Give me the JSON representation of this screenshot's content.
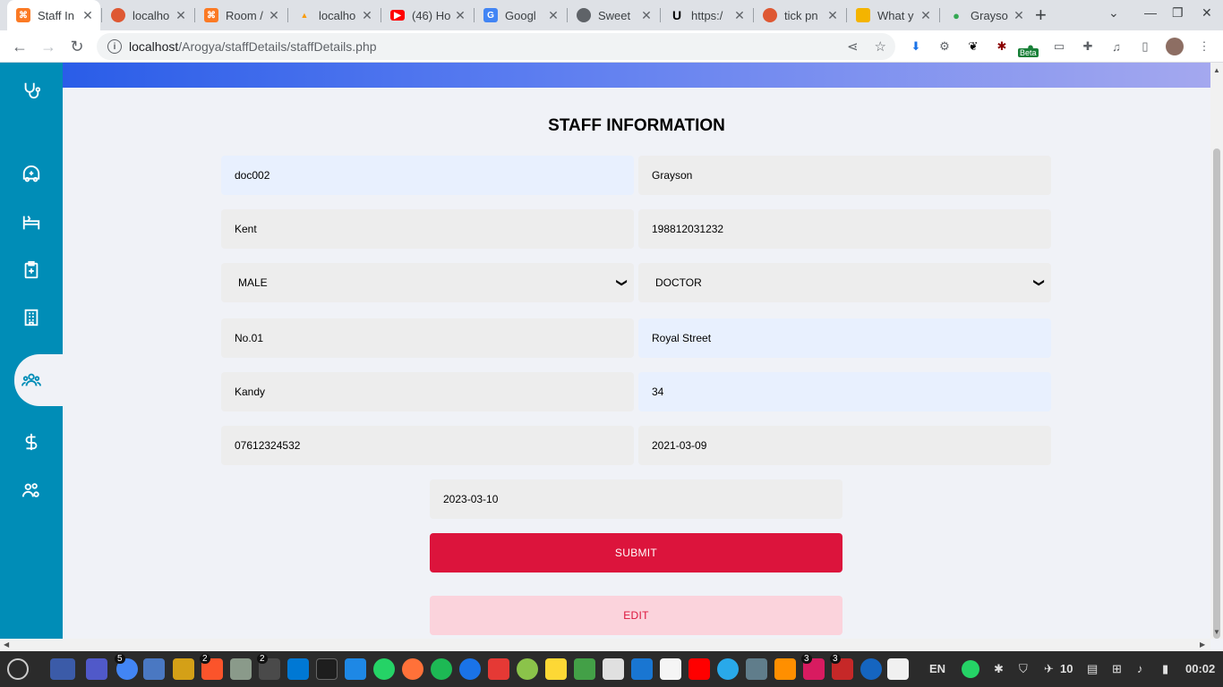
{
  "browser": {
    "tabs": [
      {
        "title": "Staff In",
        "icon": "xampp-icon",
        "color": "#fb7a24",
        "active": true
      },
      {
        "title": "localho",
        "icon": "duckduckgo-icon",
        "color": "#de5833"
      },
      {
        "title": "Room /",
        "icon": "xampp-icon",
        "color": "#fb7a24"
      },
      {
        "title": "localho",
        "icon": "phpmyadmin-icon",
        "color": "#f89c0e"
      },
      {
        "title": "(46) Ho",
        "icon": "youtube-icon",
        "color": "#ff0000"
      },
      {
        "title": "Googl",
        "icon": "google-translate-icon",
        "color": "#4285f4"
      },
      {
        "title": "Sweet",
        "icon": "globe-icon",
        "color": "#5f6368"
      },
      {
        "title": "https:/",
        "icon": "udemy-icon",
        "color": "#000000"
      },
      {
        "title": "tick pn",
        "icon": "duckduckgo-icon",
        "color": "#de5833"
      },
      {
        "title": "What y",
        "icon": "grid-icon",
        "color": "#f4b400"
      },
      {
        "title": "Grayso",
        "icon": "map-pin-icon",
        "color": "#34a853"
      }
    ],
    "url_host": "localhost",
    "url_path": "/Arogya/staffDetails/staffDetails.php",
    "extension_badge": "Beta"
  },
  "sidebar": {
    "items": [
      {
        "name": "stethoscope-icon"
      },
      {
        "name": "ambulance-icon"
      },
      {
        "name": "bed-icon"
      },
      {
        "name": "clipboard-plus-icon"
      },
      {
        "name": "hospital-building-icon"
      },
      {
        "name": "staff-group-icon",
        "active": true
      },
      {
        "name": "dollar-icon"
      },
      {
        "name": "users-settings-icon"
      }
    ]
  },
  "form": {
    "title": "STAFF INFORMATION",
    "staff_id": "doc002",
    "first_name": "Grayson",
    "last_name": "Kent",
    "nic": "198812031232",
    "gender": "MALE",
    "role": "DOCTOR",
    "address_no": "No.01",
    "street": "Royal Street",
    "city": "Kandy",
    "age": "34",
    "phone": "07612324532",
    "join_date": "2021-03-09",
    "current_date": "2023-03-10",
    "submit_label": "SUBMIT",
    "edit_label": "EDIT"
  },
  "taskbar": {
    "language": "EN",
    "clock": "00:02",
    "volume": "10",
    "badges": {
      "chrome": "5",
      "brave": "2",
      "sublime": "2",
      "chat1": "3",
      "chat2": "3"
    }
  },
  "colors": {
    "sidebar": "#008db7",
    "submit": "#dc143c",
    "edit_bg": "#fbd3dc",
    "banner_start": "#2a5de8",
    "banner_end": "#a4a8ef"
  }
}
